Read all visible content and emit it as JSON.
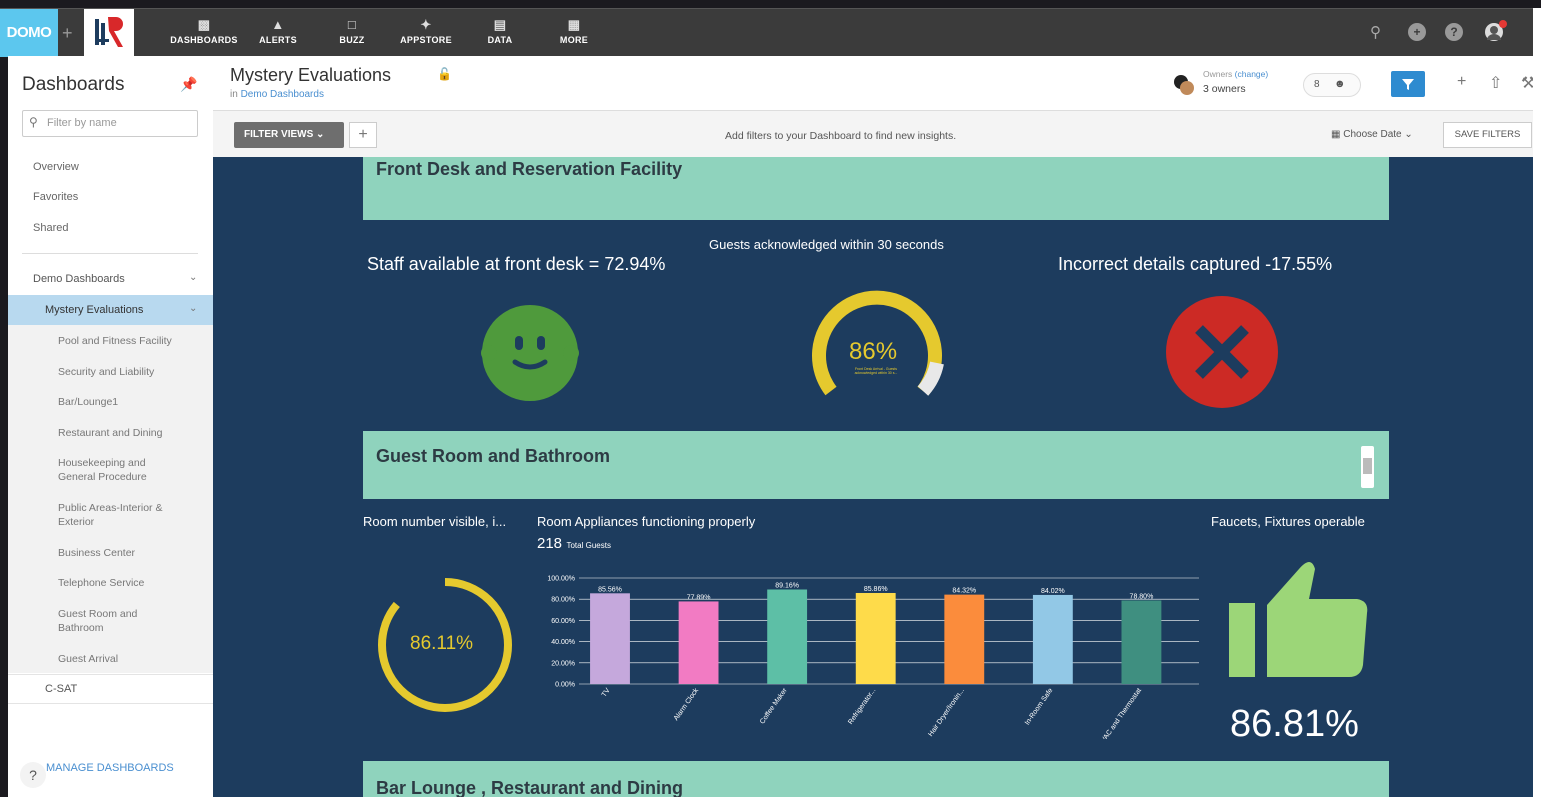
{
  "topnav": {
    "logo_text": "DOMO",
    "items": [
      {
        "label": "DASHBOARDS",
        "icon": "dashboard-icon"
      },
      {
        "label": "ALERTS",
        "icon": "bell-icon"
      },
      {
        "label": "BUZZ",
        "icon": "chat-icon"
      },
      {
        "label": "APPSTORE",
        "icon": "appstore-icon"
      },
      {
        "label": "DATA",
        "icon": "database-icon"
      },
      {
        "label": "MORE",
        "icon": "grid-icon"
      }
    ]
  },
  "sidebar": {
    "title": "Dashboards",
    "filter_placeholder": "Filter by name",
    "links": [
      "Overview",
      "Favorites",
      "Shared"
    ],
    "group_label": "Demo Dashboards",
    "active_label": "Mystery Evaluations",
    "sub_items": [
      "Pool and Fitness Facility",
      "Security and Liability",
      "Bar/Lounge1",
      "Restaurant and Dining",
      "Housekeeping and General Procedure",
      "Public Areas-Interior & Exterior",
      "Business Center",
      "Telephone Service",
      "Guest Room and Bathroom",
      "Guest Arrival"
    ],
    "csat_label": "C-SAT",
    "help": "?",
    "manage_label": "MANAGE DASHBOARDS"
  },
  "header": {
    "title": "Mystery Evaluations",
    "in_text": "in",
    "parent_link": "Demo Dashboards",
    "owners_label": "Owners",
    "owners_change": "(change)",
    "owners_count": "3 owners",
    "share_count": "8"
  },
  "filterbar": {
    "filter_views_label": "FILTER VIEWS",
    "add_label": "+",
    "message": "Add filters to your Dashboard to find new insights.",
    "date_label": "Choose Date",
    "save_label": "SAVE FILTERS"
  },
  "sections": {
    "front_desk": "Front Desk and Reservation Facility",
    "guest_room": "Guest Room and Bathroom",
    "bar_lounge": "Bar Lounge , Restaurant and Dining"
  },
  "front_desk": {
    "staff_text": "Staff available at front desk = 72.94%",
    "acknowledged_title": "Guests acknowledged within 30 seconds",
    "acknowledged_value": "86%",
    "acknowledged_caption": "Front Desk Arrival - Guests acknowledged within 30 s...",
    "gauge_fraction": 0.86,
    "incorrect_text": "Incorrect details captured -17.55%",
    "colors": {
      "smiley": "#4f9a3c",
      "gauge": "#e5c92e",
      "cross_bg": "#cc2a25"
    }
  },
  "guest_room": {
    "room_number_title": "Room number visible, i...",
    "room_number_value": "86.11%",
    "room_number_fraction": 0.8611,
    "appliances_title": "Room Appliances functioning properly",
    "total_guests": "218",
    "total_guests_label": "Total Guests",
    "faucets_title": "Faucets, Fixtures operable",
    "faucets_value": "86.81%",
    "thumb_color": "#9cd678"
  },
  "chart_data": {
    "type": "bar",
    "categories": [
      "TV",
      "Alarm Clock",
      "Coffee Maker",
      "Refrigerator...",
      "Hair Dryer/Ironin...",
      "In-Room Safe",
      "HVAC and Thermostat"
    ],
    "values": [
      85.56,
      77.89,
      89.16,
      85.86,
      84.32,
      84.02,
      78.8
    ],
    "value_labels": [
      "85.56%",
      "77.89%",
      "89.16%",
      "85.86%",
      "84.32%",
      "84.02%",
      "78.80%"
    ],
    "colors": [
      "#c5a8dc",
      "#f27bc3",
      "#5dbfa6",
      "#fedb4a",
      "#fb8c3c",
      "#92c8e6",
      "#3f8f80"
    ],
    "y_ticks": [
      "0.00%",
      "20.00%",
      "40.00%",
      "60.00%",
      "80.00%",
      "100.00%"
    ],
    "ylim": [
      0,
      100
    ],
    "grid": true
  }
}
